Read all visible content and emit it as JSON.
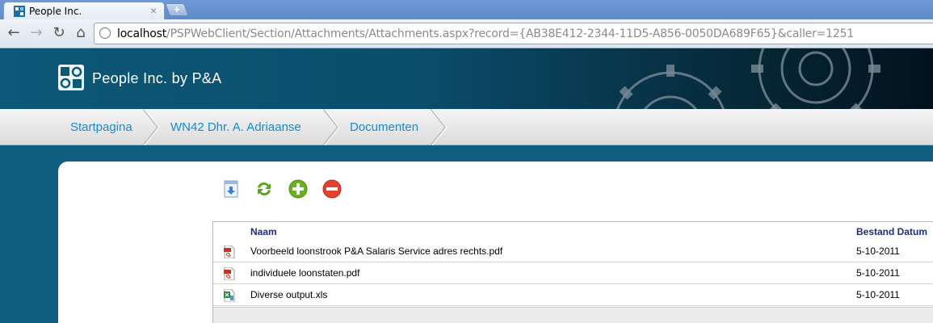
{
  "browser": {
    "tab_title": "People Inc.",
    "tab_close": "×",
    "new_tab": "+",
    "url_host": "localhost",
    "url_path": "/PSPWebClient/Section/Attachments/Attachments.aspx?record={AB38E412-2344-11D5-A856-0050DA689F65}&caller=1251",
    "nav": {
      "back": "←",
      "forward": "→",
      "reload": "↻",
      "home": "⌂"
    }
  },
  "site": {
    "title": "People Inc. by P&A"
  },
  "breadcrumb": [
    {
      "label": "Startpagina"
    },
    {
      "label": "WN42 Dhr. A. Adriaanse"
    },
    {
      "label": "Documenten"
    }
  ],
  "actions": [
    {
      "name": "download-icon",
      "color": "#3b7fd1"
    },
    {
      "name": "refresh-icon",
      "color": "#5aa51e"
    },
    {
      "name": "add-icon",
      "color": "#6bb11f"
    },
    {
      "name": "remove-icon",
      "color": "#e0442f"
    }
  ],
  "table": {
    "columns": {
      "name": "Naam",
      "date": "Bestand Datum"
    },
    "rows": [
      {
        "icon": "pdf-file-icon",
        "name": "Voorbeeld loonstrook P&A Salaris Service adres rechts.pdf",
        "date": "5-10-2011"
      },
      {
        "icon": "pdf-file-icon",
        "name": "individuele loonstaten.pdf",
        "date": "5-10-2011"
      },
      {
        "icon": "excel-file-icon",
        "name": "Diverse output.xls",
        "date": "5-10-2011"
      }
    ]
  }
}
